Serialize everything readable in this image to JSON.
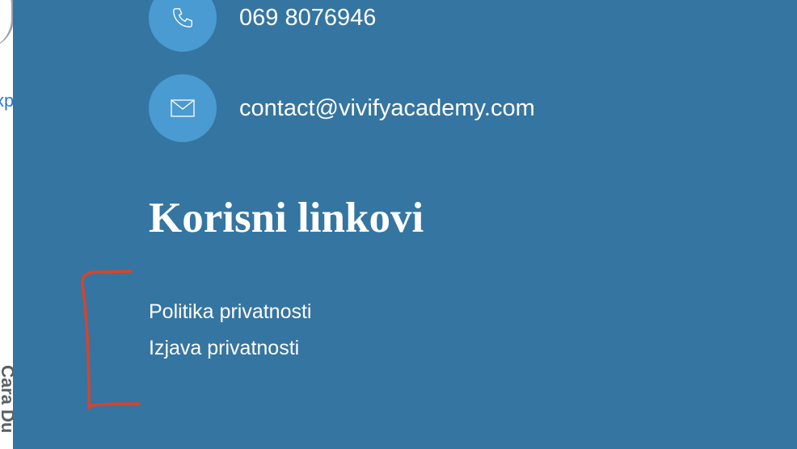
{
  "left_strip": {
    "link_fragment": "xp",
    "vertical_text": "Cara Du"
  },
  "contact": {
    "phone_icon": "phone-icon",
    "phone": "069 8076946",
    "email_icon": "envelope-icon",
    "email": "contact@vivifyacademy.com"
  },
  "useful_links": {
    "title": "Korisni linkovi",
    "items": [
      {
        "label": "Politika privatnosti"
      },
      {
        "label": "Izjava privatnosti"
      }
    ]
  },
  "colors": {
    "panel_background": "#3575a1",
    "icon_circle": "#4a9bd2",
    "text": "#ffffff",
    "annotation": "#d9432b"
  },
  "annotation": {
    "type": "hand-drawn-bracket"
  }
}
